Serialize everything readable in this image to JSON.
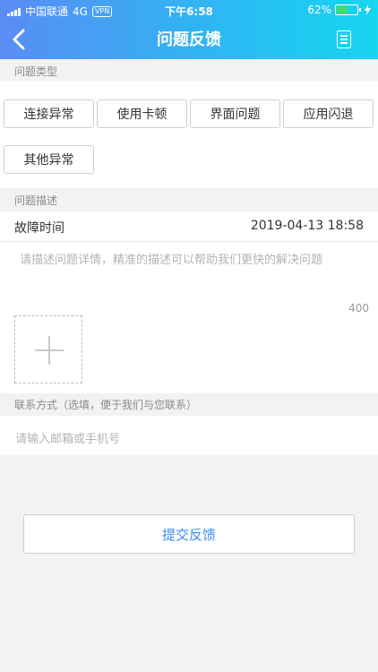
{
  "status_bar": {
    "carrier": "中国联通",
    "network": "4G",
    "vpn": "VPN",
    "time": "下午6:58",
    "battery_text": "62%",
    "battery_level": 0.62
  },
  "header": {
    "title": "问题反馈",
    "colors": {
      "gradient_start": "#5a8cf5",
      "gradient_end": "#16d6f0"
    }
  },
  "sections": {
    "type_label": "问题类型",
    "desc_label": "问题描述",
    "contact_label": "联系方式（选填，便于我们与您联系）"
  },
  "categories": [
    "连接异常",
    "使用卡顿",
    "界面问题",
    "应用闪退",
    "其他异常"
  ],
  "fault_time": {
    "label": "故障时间",
    "value": "2019-04-13 18:58"
  },
  "description": {
    "placeholder": "请描述问题详情，精准的描述可以帮助我们更快的解决问题",
    "counter": "400"
  },
  "contact": {
    "placeholder": "请输入邮箱或手机号"
  },
  "submit": {
    "label": "提交反馈",
    "color": "#3a8ef0"
  }
}
